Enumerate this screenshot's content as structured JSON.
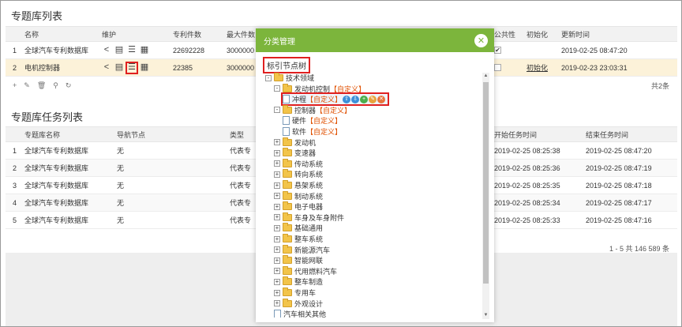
{
  "top_section": {
    "title": "专题库列表",
    "columns": [
      "名称",
      "维护",
      "专利件数",
      "最大件数",
      "公共性",
      "初始化",
      "更新时间"
    ],
    "rows": [
      {
        "idx": "1",
        "name": "全球汽车专利数据库",
        "count": "22692228",
        "max": "3000000",
        "public_checked": true,
        "init": "",
        "updated": "2019-02-25 08:47:20"
      },
      {
        "idx": "2",
        "name": "电机控制器",
        "count": "22385",
        "max": "3000000",
        "public_checked": false,
        "init": "初始化",
        "updated": "2019-02-23 23:03:31"
      }
    ],
    "total": "共2条"
  },
  "task_section": {
    "title": "专题库任务列表",
    "columns": [
      "专题库名称",
      "导航节点",
      "类型",
      "开始任务时间",
      "结束任务时间"
    ],
    "rows": [
      {
        "idx": "1",
        "name": "全球汽车专利数据库",
        "nav": "无",
        "type": "代表专",
        "start": "2019-02-25 08:25:38",
        "end": "2019-02-25 08:47:20"
      },
      {
        "idx": "2",
        "name": "全球汽车专利数据库",
        "nav": "无",
        "type": "代表专",
        "start": "2019-02-25 08:25:36",
        "end": "2019-02-25 08:47:19"
      },
      {
        "idx": "3",
        "name": "全球汽车专利数据库",
        "nav": "无",
        "type": "代表专",
        "start": "2019-02-25 08:25:35",
        "end": "2019-02-25 08:47:18"
      },
      {
        "idx": "4",
        "name": "全球汽车专利数据库",
        "nav": "无",
        "type": "代表专",
        "start": "2019-02-25 08:25:34",
        "end": "2019-02-25 08:47:17"
      },
      {
        "idx": "5",
        "name": "全球汽车专利数据库",
        "nav": "无",
        "type": "代表专",
        "start": "2019-02-25 08:25:33",
        "end": "2019-02-25 08:47:16"
      }
    ],
    "pager": "1 - 5   共 146 589 条"
  },
  "dialog": {
    "title": "分类管理",
    "tree_label": "标引节点树",
    "nodes": [
      {
        "label": "技术领域",
        "tag": ""
      },
      {
        "label": "发动机控制",
        "tag": "【自定义】"
      },
      {
        "label": "冲程",
        "tag": "【自定义】"
      },
      {
        "label": "控制器",
        "tag": "【自定义】"
      },
      {
        "label": "硬件",
        "tag": "【自定义】"
      },
      {
        "label": "软件",
        "tag": "【自定义】"
      },
      {
        "label": "发动机",
        "tag": ""
      },
      {
        "label": "变速器",
        "tag": ""
      },
      {
        "label": "传动系统",
        "tag": ""
      },
      {
        "label": "转向系统",
        "tag": ""
      },
      {
        "label": "悬架系统",
        "tag": ""
      },
      {
        "label": "制动系统",
        "tag": ""
      },
      {
        "label": "电子电器",
        "tag": ""
      },
      {
        "label": "车身及车身附件",
        "tag": ""
      },
      {
        "label": "基础通用",
        "tag": ""
      },
      {
        "label": "整车系统",
        "tag": ""
      },
      {
        "label": "新能源汽车",
        "tag": ""
      },
      {
        "label": "智能网联",
        "tag": ""
      },
      {
        "label": "代用燃料汽车",
        "tag": ""
      },
      {
        "label": "整车制造",
        "tag": ""
      },
      {
        "label": "专用车",
        "tag": ""
      },
      {
        "label": "外观设计",
        "tag": ""
      },
      {
        "label": "汽车相关其他",
        "tag": ""
      }
    ]
  },
  "colors": {
    "dialog_header": "#7cb53c",
    "highlight": "#e02020",
    "custom_tag": "#e05000"
  }
}
